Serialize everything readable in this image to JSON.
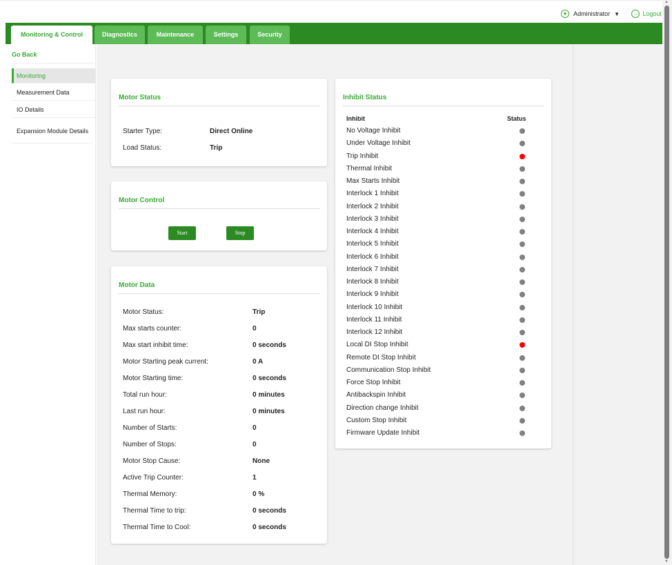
{
  "header": {
    "user": "Administrator",
    "logout": "Logout"
  },
  "tabs": [
    "Monitoring & Control",
    "Diagnostics",
    "Maintenance",
    "Settings",
    "Security"
  ],
  "sidebar": {
    "back": "Go Back",
    "items": [
      "Monitoring",
      "Measurement Data",
      "IO Details",
      "Expansion Module Details"
    ]
  },
  "motor_status": {
    "title": "Motor Status",
    "rows": [
      {
        "label": "Starter Type:",
        "value": "Direct Online"
      },
      {
        "label": "Load Status:",
        "value": "Trip"
      }
    ]
  },
  "motor_control": {
    "title": "Motor Control",
    "start": "Start",
    "stop": "Stop"
  },
  "motor_data": {
    "title": "Motor Data",
    "rows": [
      {
        "label": "Motor Status:",
        "value": "Trip"
      },
      {
        "label": "Max starts counter:",
        "value": "0"
      },
      {
        "label": "Max start inhibit time:",
        "value": "0 seconds"
      },
      {
        "label": "Motor Starting peak current:",
        "value": "0 A"
      },
      {
        "label": "Motor Starting time:",
        "value": "0 seconds"
      },
      {
        "label": "Total run hour:",
        "value": "0 minutes"
      },
      {
        "label": "Last run hour:",
        "value": "0 minutes"
      },
      {
        "label": "Number of Starts:",
        "value": "0"
      },
      {
        "label": "Number of Stops:",
        "value": "0"
      },
      {
        "label": "Motor Stop Cause:",
        "value": "None"
      },
      {
        "label": "Active Trip Counter:",
        "value": "1"
      },
      {
        "label": "Thermal Memory:",
        "value": "0 %"
      },
      {
        "label": "Thermal Time to trip:",
        "value": "0 seconds"
      },
      {
        "label": "Thermal Time to Cool:",
        "value": "0 seconds"
      }
    ]
  },
  "inhibit": {
    "title": "Inhibit Status",
    "col_name": "Inhibit",
    "col_status": "Status",
    "colors": {
      "inactive": "#808080",
      "active": "#ff0000"
    },
    "rows": [
      {
        "name": "No Voltage Inhibit",
        "status": "inactive"
      },
      {
        "name": "Under Voltage Inhibit",
        "status": "inactive"
      },
      {
        "name": "Trip Inhibit",
        "status": "active"
      },
      {
        "name": "Thermal Inhibit",
        "status": "inactive"
      },
      {
        "name": "Max Starts Inhibit",
        "status": "inactive"
      },
      {
        "name": "Interlock 1 Inhibit",
        "status": "inactive"
      },
      {
        "name": "Interlock 2 Inhibit",
        "status": "inactive"
      },
      {
        "name": "Interlock 3 Inhibit",
        "status": "inactive"
      },
      {
        "name": "Interlock 4 Inhibit",
        "status": "inactive"
      },
      {
        "name": "Interlock 5 Inhibit",
        "status": "inactive"
      },
      {
        "name": "Interlock 6 Inhibit",
        "status": "inactive"
      },
      {
        "name": "Interlock 7 Inhibit",
        "status": "inactive"
      },
      {
        "name": "Interlock 8 Inhibit",
        "status": "inactive"
      },
      {
        "name": "Interlock 9 Inhibit",
        "status": "inactive"
      },
      {
        "name": "Interlock 10 Inhibit",
        "status": "inactive"
      },
      {
        "name": "Interlock 11 Inhibit",
        "status": "inactive"
      },
      {
        "name": "Interlock 12 Inhibit",
        "status": "inactive"
      },
      {
        "name": "Local DI Stop Inhibit",
        "status": "active"
      },
      {
        "name": "Remote DI Stop Inhibit",
        "status": "inactive"
      },
      {
        "name": "Communication Stop Inhibit",
        "status": "inactive"
      },
      {
        "name": "Force Stop Inhibit",
        "status": "inactive"
      },
      {
        "name": "Antibackspin Inhibit",
        "status": "inactive"
      },
      {
        "name": "Direction change Inhibit",
        "status": "inactive"
      },
      {
        "name": "Custom Stop Inhibit",
        "status": "inactive"
      },
      {
        "name": "Firmware Update Inhibit",
        "status": "inactive"
      }
    ]
  }
}
